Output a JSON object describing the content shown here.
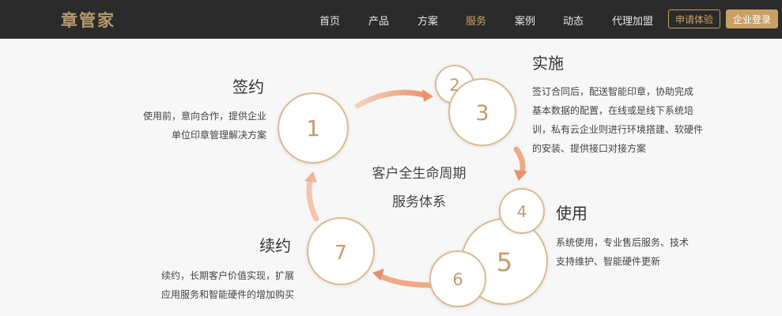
{
  "header": {
    "logo": "章管家",
    "nav": [
      "首页",
      "产品",
      "方案",
      "服务",
      "案例",
      "动态",
      "代理加盟"
    ],
    "active_nav": "服务",
    "trial_button": "申请体验",
    "login_button": "企业登录"
  },
  "cycle": {
    "center_line1": "客户全生命周期",
    "center_line2": "服务体系",
    "numbers": [
      "1",
      "2",
      "3",
      "4",
      "5",
      "6",
      "7"
    ],
    "stages": {
      "sign": {
        "title": "签约",
        "desc1": "使用前，意向合作，提供企业",
        "desc2": "单位印章管理解决方案"
      },
      "implement": {
        "title": "实施",
        "desc1": "签订合同后，配送智能印章，协助完成",
        "desc2": "基本数据的配置，在线或是线下系统培",
        "desc3": "训，私有云企业则进行环境搭建、软硬件",
        "desc4": "的安装、提供接口对接方案"
      },
      "use": {
        "title": "使用",
        "desc1": "系统使用，专业售后服务、技术",
        "desc2": "支持维护、智能硬件更新"
      },
      "renew": {
        "title": "续约",
        "desc1": "续约，长期客户价值实现，扩展",
        "desc2": "应用服务和智能硬件的增加购买"
      }
    }
  },
  "colors": {
    "accent": "#c9a063",
    "topbar": "#2b2b2b",
    "arrow": "#e99a74"
  }
}
